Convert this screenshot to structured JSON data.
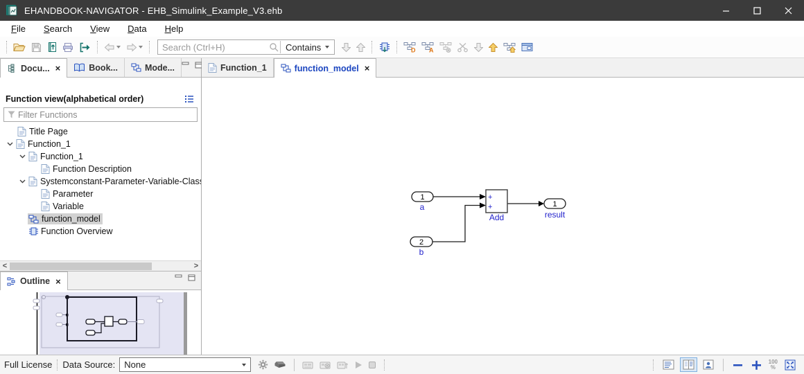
{
  "window": {
    "title": "EHANDBOOK-NAVIGATOR - EHB_Simulink_Example_V3.ehb"
  },
  "menu": {
    "file": "File",
    "search": "Search",
    "view": "View",
    "data": "Data",
    "help": "Help"
  },
  "toolbar": {
    "search_placeholder": "Search (Ctrl+H)",
    "contains_label": "Contains"
  },
  "left_tabs": {
    "documentation": "Docu...",
    "bookmarks": "Book...",
    "models": "Mode..."
  },
  "doc_panel": {
    "header": "Function view(alphabetical order)",
    "filter_placeholder": "Filter Functions",
    "tree": {
      "items": [
        {
          "label": "Title Page"
        },
        {
          "label": "Function_1"
        },
        {
          "label": "Function_1"
        },
        {
          "label": "Function Description"
        },
        {
          "label": "Systemconstant-Parameter-Variable-Classin"
        },
        {
          "label": "Parameter"
        },
        {
          "label": "Variable"
        },
        {
          "label": "function_model"
        },
        {
          "label": "Function Overview"
        }
      ]
    }
  },
  "outline": {
    "tab_label": "Outline"
  },
  "main_tabs": {
    "function_1": "Function_1",
    "function_model": "function_model"
  },
  "diagram": {
    "inport_a": {
      "number": "1",
      "label": "a"
    },
    "inport_b": {
      "number": "2",
      "label": "b"
    },
    "add_block": {
      "sign_top": "+",
      "sign_bottom": "+",
      "label": "Add"
    },
    "outport": {
      "number": "1",
      "label": "result"
    }
  },
  "statusbar": {
    "license": "Full License",
    "data_source_label": "Data Source:",
    "data_source_value": "None",
    "zoom_reset_top": "100",
    "zoom_reset_bottom": "%"
  },
  "colors": {
    "titlebar": "#3b3b3b",
    "accent_blue": "#2a52be",
    "diagram_label_blue": "#2222cc",
    "outline_thumbnail_bg": "#e4e4f3"
  }
}
